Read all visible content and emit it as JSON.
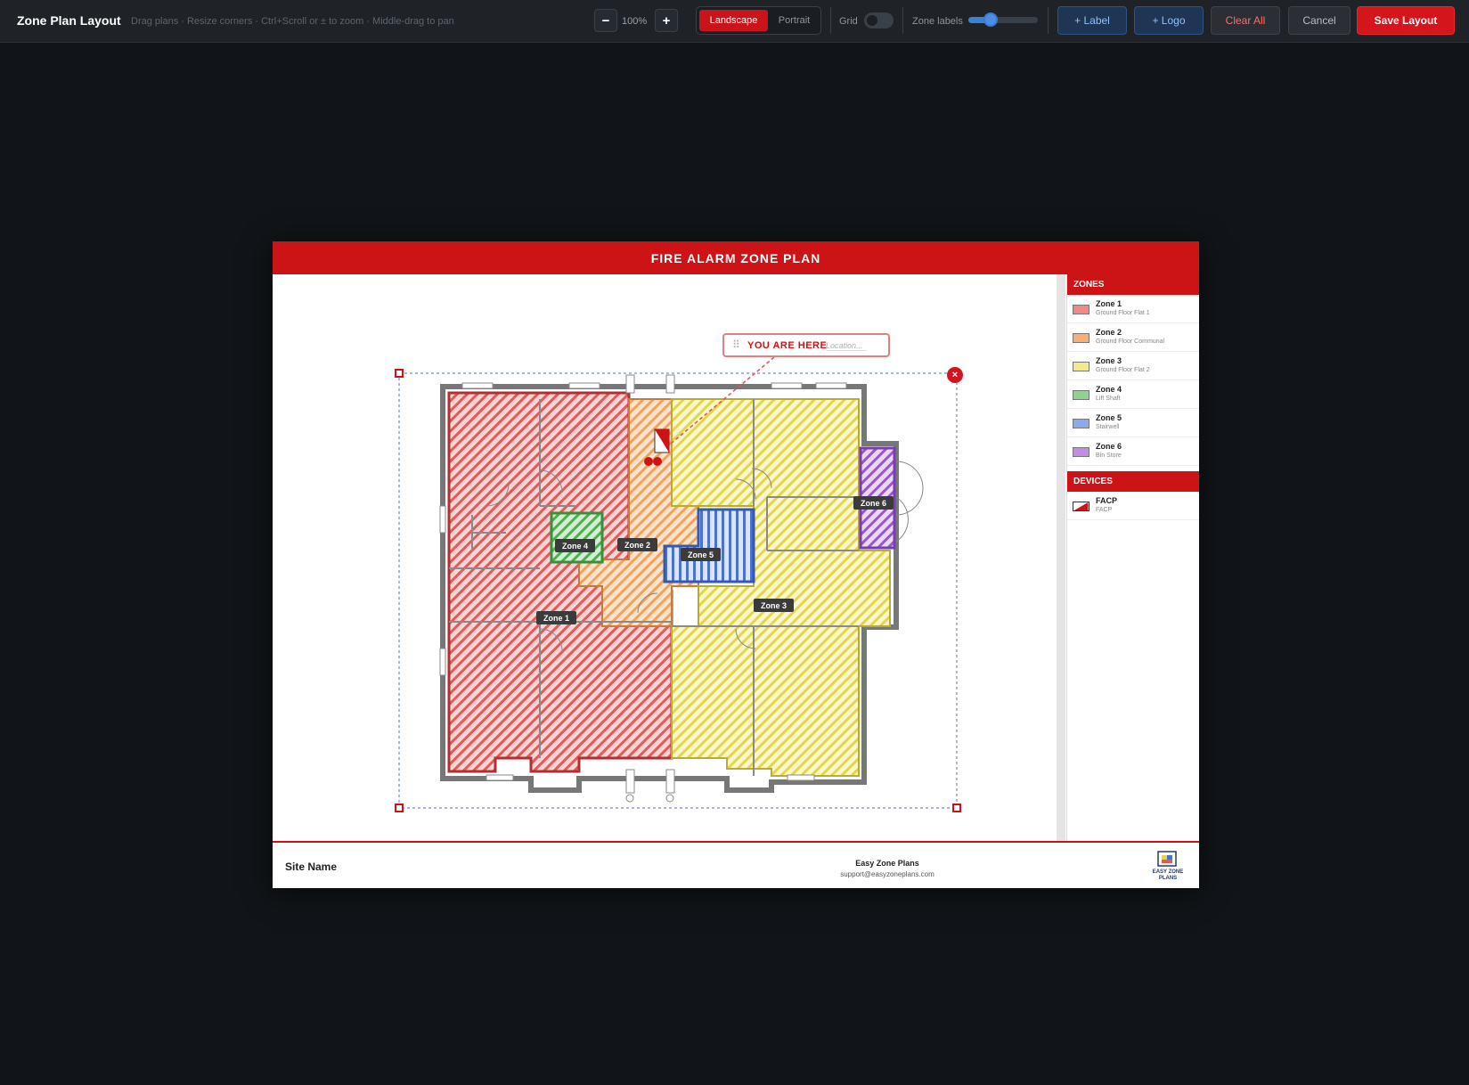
{
  "toolbar": {
    "title": "Zone Plan Layout",
    "hint": "Drag plans · Resize corners · Ctrl+Scroll or ± to zoom · Middle-drag to pan",
    "zoom_out": "−",
    "zoom_level": "100%",
    "zoom_in": "+",
    "orientation": {
      "active": "Landscape",
      "inactive": "Portrait"
    },
    "grid_label": "Grid",
    "grid_enabled": false,
    "zone_labels_label": "Zone labels",
    "zone_labels_level": 0.35,
    "add_label": "+ Label",
    "add_logo": "+ Logo",
    "clear_all": "Clear All",
    "cancel": "Cancel",
    "save": "Save Layout"
  },
  "page": {
    "title": "FIRE ALARM ZONE PLAN",
    "you_are_here": "YOU ARE HERE",
    "location_placeholder": "Location...",
    "zone_tags": [
      "Zone 1",
      "Zone 2",
      "Zone 3",
      "Zone 4",
      "Zone 5",
      "Zone 6"
    ],
    "legend": {
      "zones_title": "ZONES",
      "zones": [
        {
          "name": "Zone 1",
          "desc": "Ground Floor Flat 1",
          "color": "#f08a8a"
        },
        {
          "name": "Zone 2",
          "desc": "Ground Floor Communal",
          "color": "#f5b07a"
        },
        {
          "name": "Zone 3",
          "desc": "Ground Floor Flat 2",
          "color": "#f3ea8a"
        },
        {
          "name": "Zone 4",
          "desc": "Lift Shaft",
          "color": "#8fd18f"
        },
        {
          "name": "Zone 5",
          "desc": "Stairwell",
          "color": "#8fa9e6"
        },
        {
          "name": "Zone 6",
          "desc": "Bin Store",
          "color": "#c08ee0"
        }
      ],
      "devices_title": "DEVICES",
      "devices": [
        {
          "name": "FACP",
          "desc": "FACP",
          "icon": "facp-icon"
        }
      ]
    },
    "footer": {
      "site_name": "Site Name",
      "company": "Easy Zone Plans",
      "email": "support@easyzoneplans.com",
      "logo_text": "EASY ZONE PLANS"
    }
  }
}
